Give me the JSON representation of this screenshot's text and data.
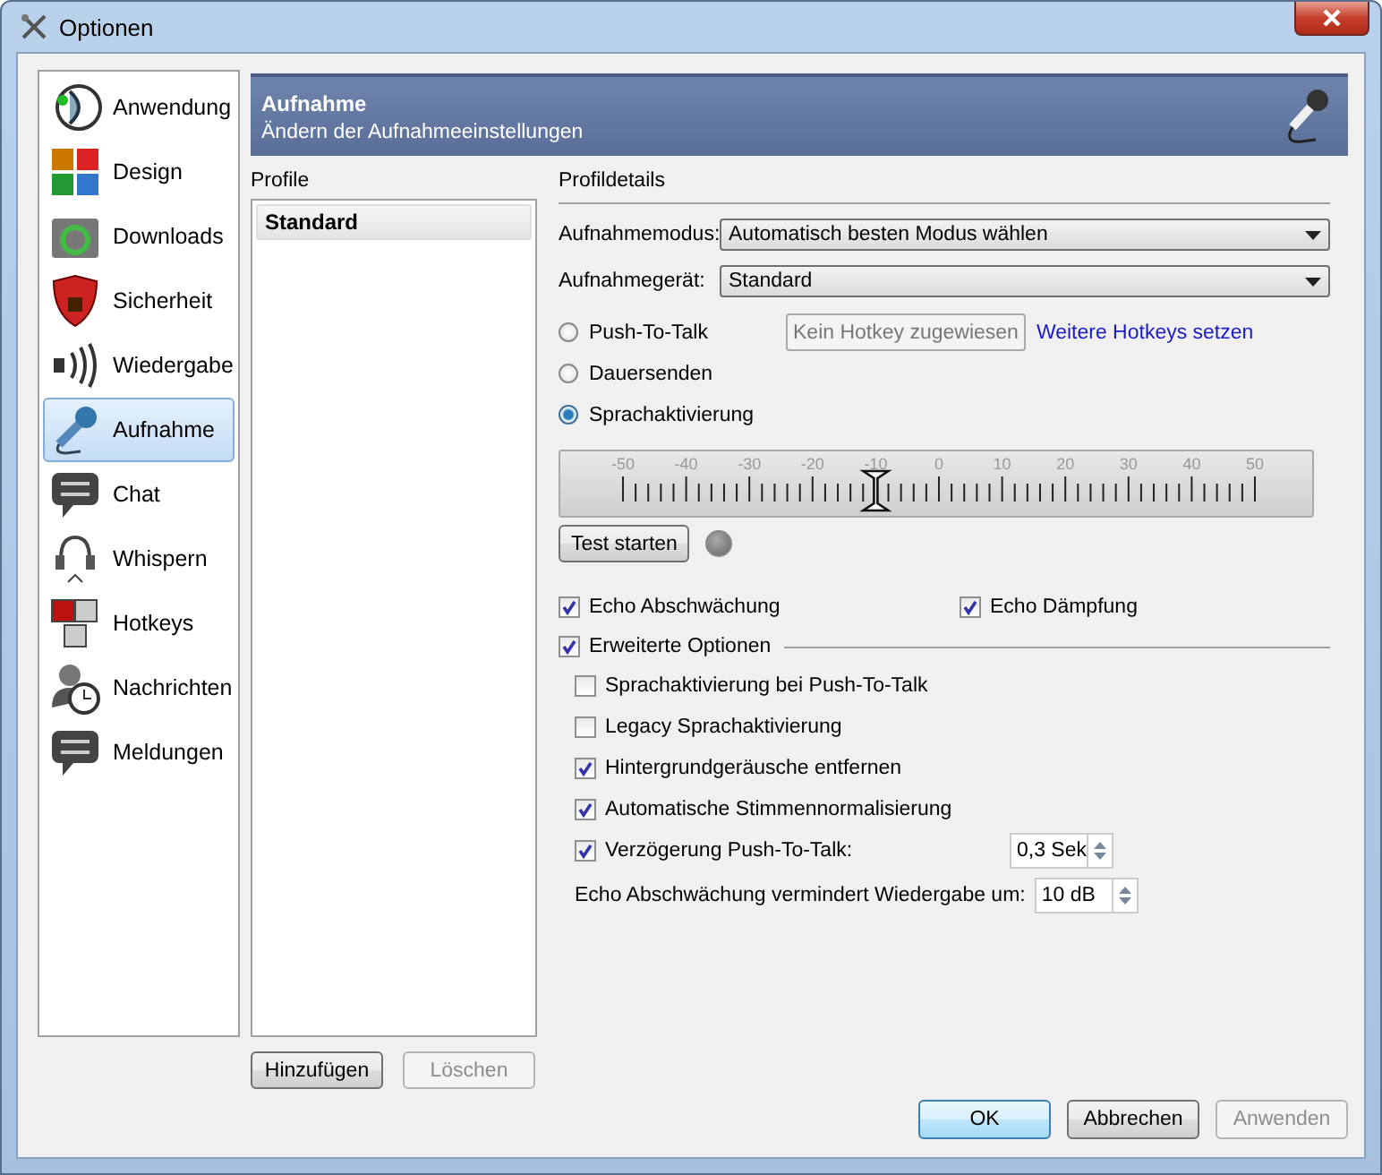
{
  "window": {
    "title": "Optionen"
  },
  "sidebar": {
    "items": [
      {
        "label": "Anwendung",
        "selected": false
      },
      {
        "label": "Design",
        "selected": false
      },
      {
        "label": "Downloads",
        "selected": false
      },
      {
        "label": "Sicherheit",
        "selected": false
      },
      {
        "label": "Wiedergabe",
        "selected": false
      },
      {
        "label": "Aufnahme",
        "selected": true
      },
      {
        "label": "Chat",
        "selected": false
      },
      {
        "label": "Whispern",
        "selected": false
      },
      {
        "label": "Hotkeys",
        "selected": false
      },
      {
        "label": "Nachrichten",
        "selected": false
      },
      {
        "label": "Meldungen",
        "selected": false
      }
    ]
  },
  "header": {
    "title": "Aufnahme",
    "subtitle": "Ändern der Aufnahmeeinstellungen"
  },
  "profiles": {
    "label": "Profile",
    "items": [
      {
        "label": "Standard",
        "selected": true
      }
    ],
    "buttons": [
      {
        "label": "Hinzufügen",
        "disabled": false
      },
      {
        "label": "Löschen",
        "disabled": true
      }
    ]
  },
  "details": {
    "label": "Profildetails",
    "fields": [
      {
        "label": "Aufnahmemodus:",
        "value": "Automatisch besten Modus wählen"
      },
      {
        "label": "Aufnahmegerät:",
        "value": "Standard"
      }
    ],
    "modes": [
      {
        "label": "Push-To-Talk",
        "selected": false,
        "hotkey": "Kein Hotkey zugewiesen",
        "link": "Weitere Hotkeys setzen"
      },
      {
        "label": "Dauersenden",
        "selected": false
      },
      {
        "label": "Sprachaktivierung",
        "selected": true
      }
    ],
    "threshold": {
      "ticks": [
        "-50",
        "-40",
        "-30",
        "-20",
        "-10",
        "0",
        "10",
        "20",
        "30",
        "40",
        "50"
      ],
      "level": 0.4
    },
    "test_button": "Test starten",
    "echo_options": [
      {
        "label": "Echo Abschwächung",
        "checked": true
      },
      {
        "label": "Echo Dämpfung",
        "checked": true
      }
    ],
    "advanced": {
      "label": "Erweiterte Optionen",
      "checked": true,
      "options": [
        {
          "kind": "checkbox",
          "label": "Sprachaktivierung bei Push-To-Talk",
          "checked": false
        },
        {
          "kind": "checkbox",
          "label": "Legacy Sprachaktivierung",
          "checked": false
        },
        {
          "kind": "checkbox",
          "label": "Hintergrundgeräusche entfernen",
          "checked": true
        },
        {
          "kind": "checkbox",
          "label": "Automatische Stimmennormalisierung",
          "checked": true
        },
        {
          "kind": "checkbox_spin",
          "label": "Verzögerung Push-To-Talk:",
          "checked": true,
          "value": "0,3 Sek"
        },
        {
          "kind": "spin",
          "label": "Echo Abschwächung vermindert Wiedergabe um:",
          "value": "10 dB"
        }
      ]
    }
  },
  "buttons": [
    {
      "label": "OK",
      "default": true,
      "disabled": false
    },
    {
      "label": "Abbrechen",
      "default": false,
      "disabled": false
    },
    {
      "label": "Anwenden",
      "default": false,
      "disabled": true
    }
  ]
}
